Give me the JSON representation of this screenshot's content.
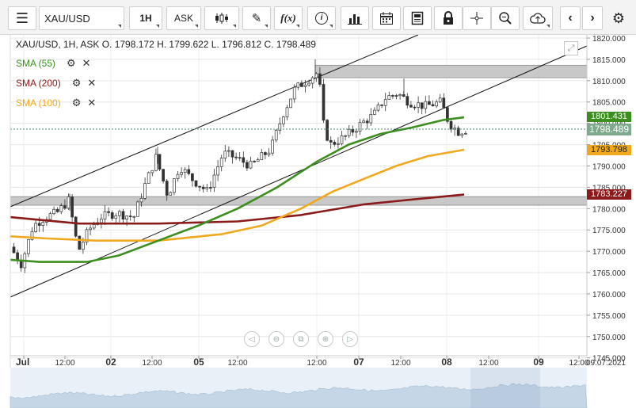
{
  "toolbar": {
    "symbol": "XAU/USD",
    "timeframe": "1H",
    "price_side": "ASK",
    "buttons": [
      "menu",
      "chart-type",
      "draw",
      "indicators",
      "info",
      "volume",
      "calendar",
      "news",
      "lock",
      "crosshair",
      "zoom",
      "upload",
      "back",
      "forward",
      "settings"
    ]
  },
  "header": {
    "text": "XAU/USD, 1H, ASK   O. 1798.172 H. 1799.622 L. 1796.812 C. 1798.489"
  },
  "legend": [
    {
      "label": "SMA (55)",
      "color": "#3c8f1e"
    },
    {
      "label": "SMA (200)",
      "color": "#8b1a1a"
    },
    {
      "label": "SMA (100)",
      "color": "#f0a81e"
    }
  ],
  "price_axis": {
    "labels": [
      "1820.000",
      "1815.000",
      "1810.000",
      "1805.000",
      "1800.000",
      "1795.000",
      "1790.000",
      "1785.000",
      "1780.000",
      "1775.000",
      "1770.000",
      "1765.000",
      "1760.000",
      "1755.000",
      "1750.000",
      "1745.000"
    ],
    "values": [
      1820,
      1815,
      1810,
      1805,
      1800,
      1795,
      1790,
      1785,
      1780,
      1775,
      1770,
      1765,
      1760,
      1755,
      1750,
      1745
    ]
  },
  "price_tags": [
    {
      "label": "1801.431",
      "value": 1801.431,
      "color": "#3c8f1e"
    },
    {
      "label": "1798.489",
      "value": 1798.489,
      "color": "#7fa98c"
    },
    {
      "label": "1793.798",
      "value": 1793.798,
      "color": "#f0a81e"
    },
    {
      "label": "1783.227",
      "value": 1783.227,
      "color": "#8b1a1a"
    }
  ],
  "time_axis": {
    "labels": [
      "Jul",
      "12:00",
      "02",
      "12:00",
      "05",
      "12:00",
      "12:00",
      "07",
      "12:00",
      "08",
      "12:00",
      "09",
      "12:00",
      "09.07.2021"
    ],
    "bold": [
      true,
      false,
      true,
      false,
      true,
      false,
      false,
      true,
      false,
      true,
      false,
      true,
      false,
      false
    ]
  },
  "colors": {
    "sma55": "#3c8f1e",
    "sma200": "#8b1a1a",
    "sma100": "#f0a81e",
    "candle": "#333333",
    "zone": "#c8c8c8"
  }
}
